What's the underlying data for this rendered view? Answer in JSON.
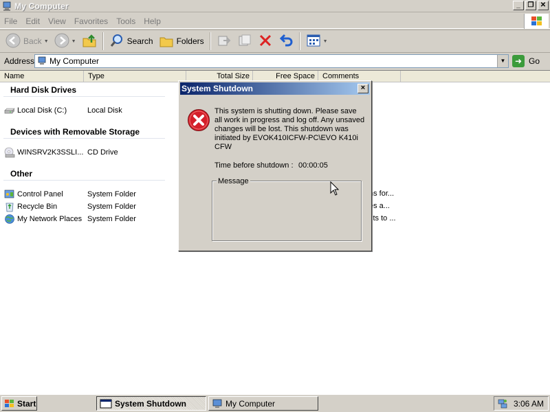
{
  "window": {
    "title": "My Computer"
  },
  "menubar": {
    "items": [
      "File",
      "Edit",
      "View",
      "Favorites",
      "Tools",
      "Help"
    ]
  },
  "toolbar": {
    "back": "Back",
    "search": "Search",
    "folders": "Folders"
  },
  "address": {
    "label": "Address",
    "value": "My Computer",
    "go": "Go"
  },
  "columns": [
    "Name",
    "Type",
    "Total Size",
    "Free Space",
    "Comments"
  ],
  "groups": [
    {
      "title": "Hard Disk Drives",
      "items": [
        {
          "name": "Local Disk (C:)",
          "type": "Local Disk",
          "icon": "hard-disk-icon"
        }
      ]
    },
    {
      "title": "Devices with Removable Storage",
      "items": [
        {
          "name": "WINSRV2K3SSLI...",
          "type": "CD Drive",
          "icon": "cd-drive-icon"
        }
      ]
    },
    {
      "title": "Other",
      "items": [
        {
          "name": "Control Panel",
          "type": "System Folder",
          "icon": "control-panel-icon",
          "comment": "ns for..."
        },
        {
          "name": "Recycle Bin",
          "type": "System Folder",
          "icon": "recycle-bin-icon",
          "comment": "es a..."
        },
        {
          "name": "My Network Places",
          "type": "System Folder",
          "icon": "network-places-icon",
          "comment": "cts to ..."
        }
      ]
    }
  ],
  "dialog": {
    "title": "System Shutdown",
    "close": "×",
    "message": "This system is shutting down. Please save all work in progress and log off. Any unsaved changes will be lost. This shutdown was initiated by EVOK410ICFW-PC\\EVO K410i CFW",
    "time_label": "Time before shutdown :",
    "time_value": "00:00:05",
    "message_group_label": "Message"
  },
  "taskbar": {
    "start": "Start",
    "tasks": [
      "System Shutdown",
      "My Computer"
    ],
    "clock": "3:06 AM"
  },
  "colors": {
    "dialog_title_start": "#0a246a",
    "dialog_title_end": "#a6caf0",
    "error_red": "#d4202a"
  }
}
